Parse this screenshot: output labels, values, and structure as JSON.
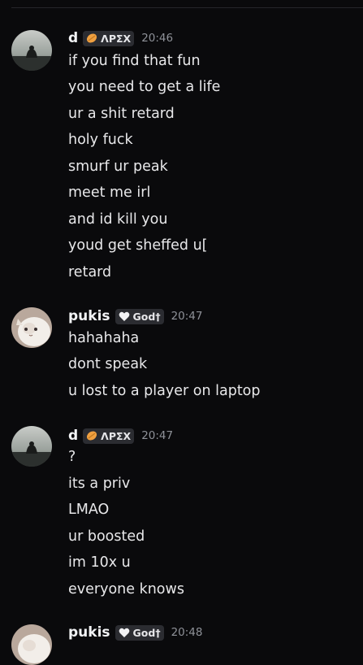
{
  "groups": [
    {
      "username": "d",
      "tag": "ΛΡΣΧ",
      "tag_icon": "orange-pill-icon",
      "time": "20:46",
      "lines": [
        "if you find that fun",
        "you need to get a life",
        "ur a shit retard",
        "holy fuck",
        "smurf ur peak",
        "meet me irl",
        "and id kill you",
        "youd get sheffed u[",
        "retard"
      ]
    },
    {
      "username": "pukis",
      "tag": "God†",
      "tag_icon": "white-heart-icon",
      "time": "20:47",
      "lines": [
        "hahahaha",
        "dont speak",
        "u lost to a player on laptop"
      ]
    },
    {
      "username": "d",
      "tag": "ΛΡΣΧ",
      "tag_icon": "orange-pill-icon",
      "time": "20:47",
      "lines": [
        "?",
        "its a priv",
        "LMAO",
        "ur boosted",
        "im 10x u",
        "everyone knows"
      ]
    },
    {
      "username": "pukis",
      "tag": "God†",
      "tag_icon": "white-heart-icon",
      "time": "20:48",
      "lines": []
    }
  ],
  "colors": {
    "background": "#0a0a0c",
    "tag_background": "#2b2c31",
    "timestamp": "#8e9198",
    "orange_badge": "#f0a040"
  }
}
